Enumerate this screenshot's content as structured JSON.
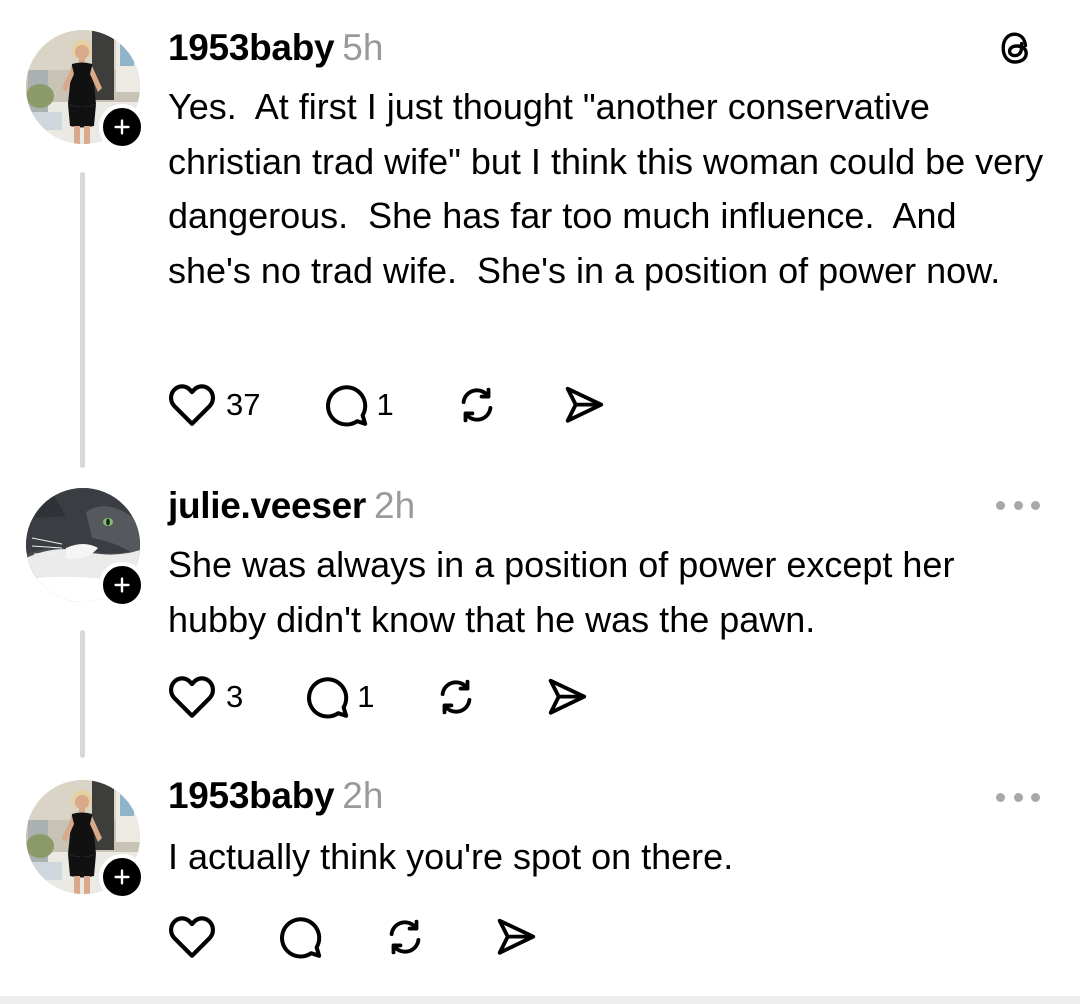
{
  "posts": [
    {
      "username": "1953baby",
      "time": "5h",
      "text": "Yes.  At first I just thought \"another conservative christian trad wife\" but I think this woman could be very dangerous.  She has far too much influence.  And she's no trad wife.  She's in a position of power now.",
      "likes": "37",
      "replies": "1",
      "avatar": "woman-in-black-dress-photo",
      "corner_icon": "threads-logo-icon"
    },
    {
      "username": "julie.veeser",
      "time": "2h",
      "text": "She was always in a position of power except her hubby didn't know that he was the pawn.",
      "likes": "3",
      "replies": "1",
      "avatar": "gray-white-cat-photo",
      "corner_icon": "more-options-icon"
    },
    {
      "username": "1953baby",
      "time": "2h",
      "text": "I actually think you're spot on there.",
      "likes": "",
      "replies": "",
      "avatar": "woman-in-black-dress-photo",
      "corner_icon": "more-options-icon"
    }
  ],
  "icons": {
    "like": "heart-icon",
    "reply": "speech-bubble-icon",
    "repost": "repost-arrows-icon",
    "share": "send-plane-icon",
    "follow": "plus-icon"
  },
  "colors": {
    "text": "#000000",
    "timestamp": "#9a9a9a",
    "thread_line": "#d8d8d8",
    "badge": "#000000"
  }
}
